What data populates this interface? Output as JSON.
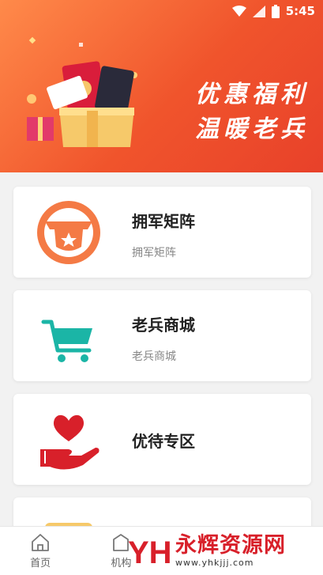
{
  "status_bar": {
    "time": "5:45"
  },
  "banner": {
    "line1": "优惠福利",
    "line2": "温暖老兵"
  },
  "cards": [
    {
      "title": "拥军矩阵",
      "subtitle": "拥军矩阵",
      "icon": "shield-star-icon"
    },
    {
      "title": "老兵商城",
      "subtitle": "老兵商城",
      "icon": "shopping-cart-icon"
    },
    {
      "title": "优待专区",
      "subtitle": "",
      "icon": "heart-hand-icon"
    }
  ],
  "tabbar": {
    "items": [
      {
        "label": "首页",
        "icon": "home-icon"
      },
      {
        "label": "机构",
        "icon": "building-icon"
      }
    ]
  },
  "watermark": {
    "name": "永辉资源网",
    "url": "www.yhkjjj.com",
    "logo": "YH"
  },
  "colors": {
    "accent": "#f0542c",
    "teal": "#1bb5a6",
    "red": "#d8202a",
    "orange": "#f47a45"
  }
}
